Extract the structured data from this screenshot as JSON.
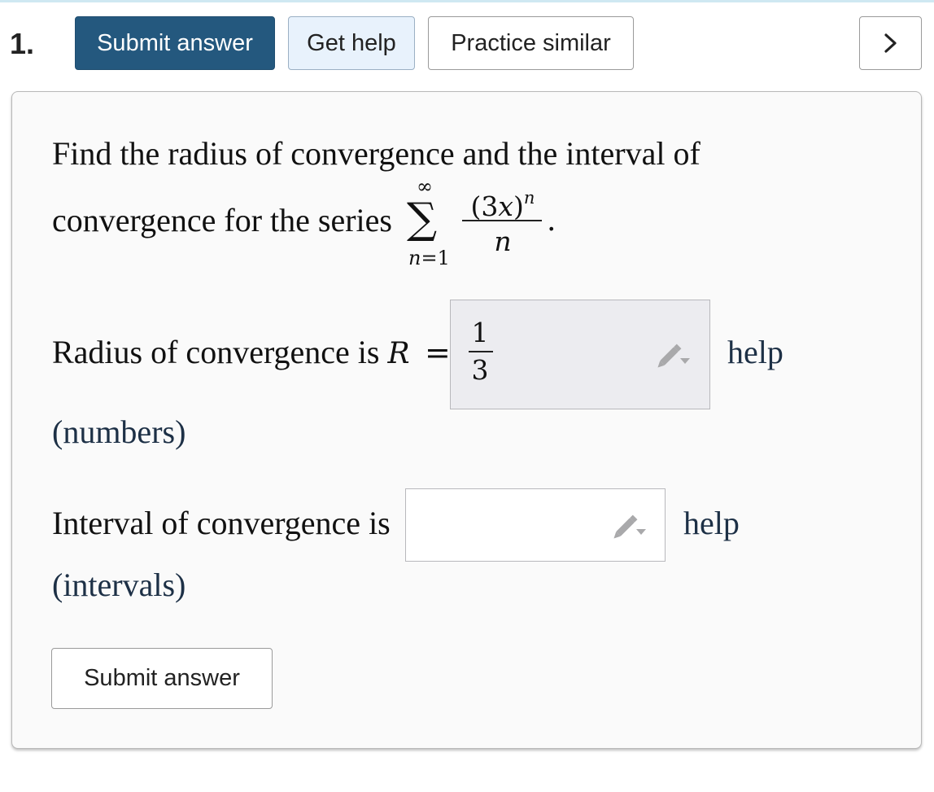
{
  "question": {
    "number": "1.",
    "statement_line1": "Find the radius of convergence and the interval of",
    "statement_line2": "convergence for the series",
    "series": {
      "sum_symbol": "∑",
      "upper_limit": "∞",
      "lower_limit": "n=1",
      "numerator_base": "(3x)",
      "numerator_exponent": "n",
      "denominator": "n",
      "terminator": "."
    }
  },
  "toolbar": {
    "submit_label": "Submit answer",
    "get_help_label": "Get help",
    "practice_label": "Practice similar",
    "next_label": ">"
  },
  "radius": {
    "label_prefix": "Radius of convergence is ",
    "variable": "R",
    "equals": "=",
    "answer_numerator": "1",
    "answer_denominator": "3",
    "help_label": "help",
    "hint": "(numbers)"
  },
  "interval": {
    "label": "Interval of convergence is",
    "answer_value": "",
    "help_label": "help",
    "hint": "(intervals)"
  },
  "footer": {
    "submit_label": "Submit answer"
  },
  "icons": {
    "edit": "pencil-icon",
    "next": "chevron-right-icon"
  },
  "colors": {
    "primary_button": "#24587e",
    "help_button": "#e8f2fc",
    "answer_filled_bg": "#ececf0",
    "link_text": "#1d3046",
    "card_bg": "#fafafa"
  }
}
